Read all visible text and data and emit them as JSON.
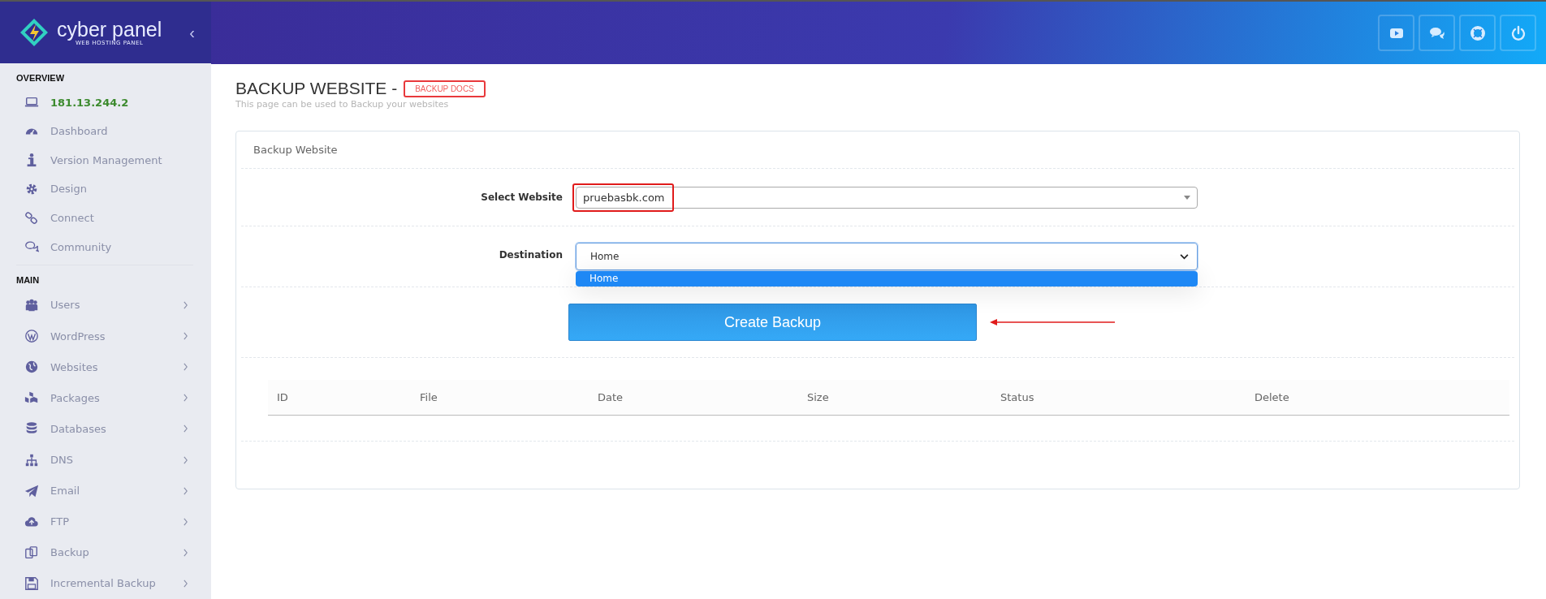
{
  "brand": {
    "name": "cyber panel",
    "tagline": "WEB HOSTING PANEL",
    "collapse": "‹"
  },
  "sidebar": {
    "sections": [
      {
        "title": "OVERVIEW",
        "items": [
          {
            "label": "181.13.244.2",
            "kind": "address",
            "has_submenu": false
          },
          {
            "label": "Dashboard",
            "kind": "link",
            "has_submenu": false
          },
          {
            "label": "Version Management",
            "kind": "link",
            "has_submenu": false
          },
          {
            "label": "Design",
            "kind": "link",
            "has_submenu": false
          },
          {
            "label": "Connect",
            "kind": "link",
            "has_submenu": false
          },
          {
            "label": "Community",
            "kind": "link",
            "has_submenu": false
          }
        ]
      },
      {
        "title": "MAIN",
        "items": [
          {
            "label": "Users",
            "kind": "link",
            "has_submenu": true
          },
          {
            "label": "WordPress",
            "kind": "link",
            "has_submenu": true
          },
          {
            "label": "Websites",
            "kind": "link",
            "has_submenu": true
          },
          {
            "label": "Packages",
            "kind": "link",
            "has_submenu": true
          },
          {
            "label": "Databases",
            "kind": "link",
            "has_submenu": true
          },
          {
            "label": "DNS",
            "kind": "link",
            "has_submenu": true
          },
          {
            "label": "Email",
            "kind": "link",
            "has_submenu": true
          },
          {
            "label": "FTP",
            "kind": "link",
            "has_submenu": true
          },
          {
            "label": "Backup",
            "kind": "link",
            "has_submenu": true
          },
          {
            "label": "Incremental Backup",
            "kind": "link",
            "has_submenu": true
          }
        ]
      }
    ]
  },
  "page": {
    "title": "BACKUP WEBSITE -",
    "docs_link": "BACKUP DOCS",
    "subtitle": "This page can be used to Backup your websites"
  },
  "card": {
    "title": "Backup Website",
    "fields": [
      {
        "label": "Select Website",
        "value": "pruebasbk.com",
        "kind": "combo",
        "highlighted": true
      },
      {
        "label": "Destination",
        "value": "Home",
        "kind": "select",
        "highlighted": false,
        "options": [
          {
            "label": "Home",
            "selected": true
          }
        ]
      }
    ],
    "button": {
      "label": "Create Backup",
      "pointed_by_arrow": true
    },
    "table": {
      "columns": [
        "ID",
        "File",
        "Date",
        "Size",
        "Status",
        "Delete"
      ]
    }
  }
}
